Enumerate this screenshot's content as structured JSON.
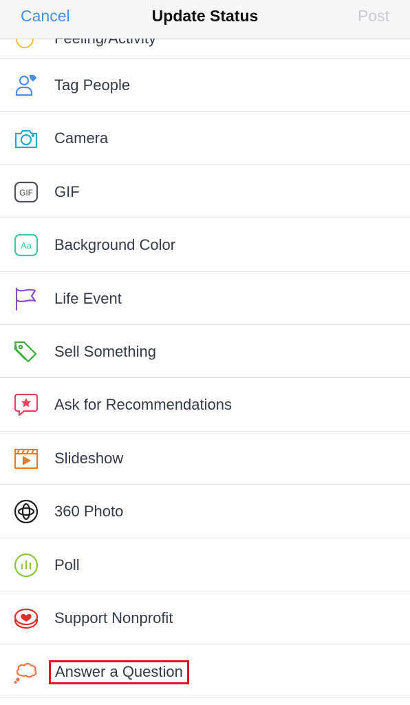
{
  "nav": {
    "cancel": "Cancel",
    "title": "Update Status",
    "post": "Post"
  },
  "partial_row": {
    "label": "Feeling/Activity"
  },
  "items": [
    {
      "label": "Tag People",
      "icon": "tag-people-icon",
      "color": "#4a90e2"
    },
    {
      "label": "Camera",
      "icon": "camera-icon",
      "color": "#29a8c8"
    },
    {
      "label": "GIF",
      "icon": "gif-icon",
      "color": "#4b4f56"
    },
    {
      "label": "Background Color",
      "icon": "background-color-icon",
      "color": "#3cc7a6"
    },
    {
      "label": "Life Event",
      "icon": "flag-icon",
      "color": "#8a4ccf"
    },
    {
      "label": "Sell Something",
      "icon": "price-tag-icon",
      "color": "#3aad3a"
    },
    {
      "label": "Ask for Recommendations",
      "icon": "star-bubble-icon",
      "color": "#e94361"
    },
    {
      "label": "Slideshow",
      "icon": "slideshow-icon",
      "color": "#f47a20"
    },
    {
      "label": "360 Photo",
      "icon": "360-photo-icon",
      "color": "#1c1e21"
    },
    {
      "label": "Poll",
      "icon": "poll-icon",
      "color": "#8cc63f"
    },
    {
      "label": "Support Nonprofit",
      "icon": "heart-badge-icon",
      "color": "#e32b2b"
    },
    {
      "label": "Answer a Question",
      "icon": "thought-bubble-icon",
      "color": "#f3764a"
    }
  ],
  "colors": {
    "accent": "#4a90e2",
    "disabled": "#c8cbd1",
    "highlight_box": "#e8111d"
  }
}
